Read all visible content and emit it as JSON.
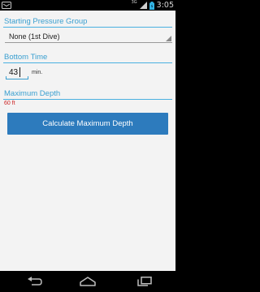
{
  "status_bar": {
    "signal_label": "3G",
    "clock": "3:05"
  },
  "form": {
    "pressure_group": {
      "label": "Starting Pressure Group",
      "selected": "None (1st Dive)"
    },
    "bottom_time": {
      "label": "Bottom Time",
      "value": "43",
      "unit": "min."
    },
    "max_depth": {
      "label": "Maximum Depth",
      "result": "60 ft"
    },
    "calculate_button": "Calculate Maximum Depth"
  },
  "colors": {
    "accent": "#3a9fd0",
    "button": "#2d7bbd",
    "result": "#cc2222",
    "background": "#f3f3f3"
  },
  "nav_bar": {
    "icons": [
      "back-icon",
      "home-icon",
      "recent-apps-icon"
    ]
  }
}
